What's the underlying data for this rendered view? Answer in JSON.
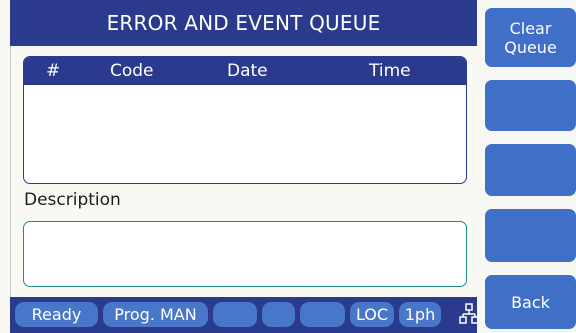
{
  "screen": {
    "title": "ERROR AND EVENT QUEUE"
  },
  "queue_table": {
    "columns": [
      "#",
      "Code",
      "Date",
      "Time"
    ],
    "rows": []
  },
  "description": {
    "label": "Description",
    "value": ""
  },
  "softkeys": {
    "clear_queue": "Clear\nQueue",
    "key2": "",
    "key3": "",
    "key4": "",
    "back": "Back"
  },
  "status_bar": {
    "state": "Ready",
    "program": "Prog. MAN",
    "slot3": "",
    "slot4": "",
    "slot5": "",
    "mode": "LOC",
    "phase": "1ph",
    "network_icon": "network-icon"
  },
  "colors": {
    "header_blue": "#2a3a8c",
    "button_blue": "#3f6fc6",
    "status_pill": "#4876c8",
    "description_border": "#1e8a8a"
  }
}
